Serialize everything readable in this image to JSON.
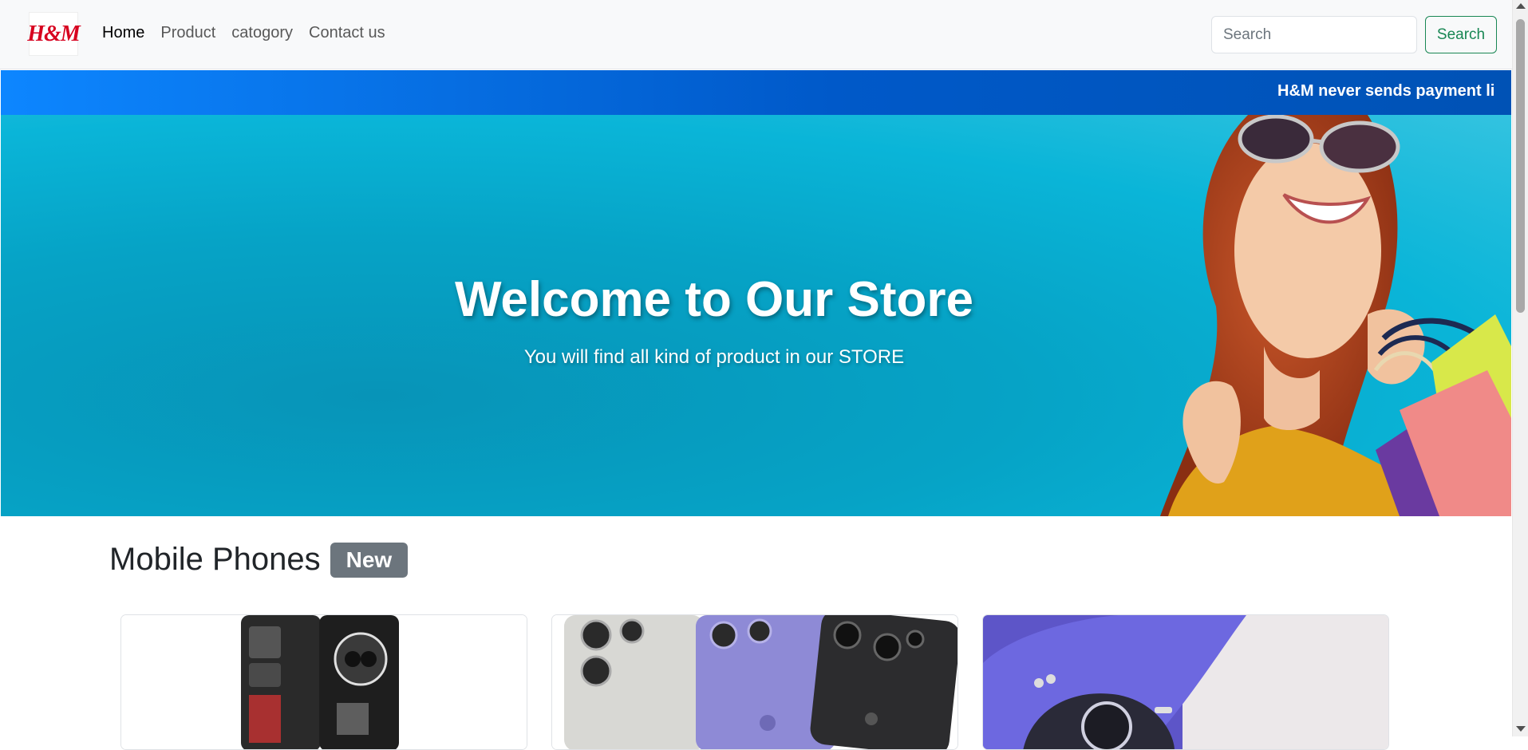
{
  "brand": {
    "logo_text": "H&M"
  },
  "nav": {
    "links": [
      {
        "label": "Home",
        "active": true
      },
      {
        "label": "Product",
        "active": false
      },
      {
        "label": "catogory",
        "active": false
      },
      {
        "label": "Contact us",
        "active": false
      }
    ]
  },
  "search": {
    "placeholder": "Search",
    "button_label": "Search"
  },
  "marquee": {
    "text": "H&M never sends payment li"
  },
  "hero": {
    "title": "Welcome to Our Store",
    "subtitle": "You will find all kind of product in our STORE"
  },
  "section": {
    "title": "Mobile Phones",
    "badge": "New"
  },
  "colors": {
    "search_button": "#198754",
    "badge": "#6c757d",
    "marquee_start": "#0d86ff",
    "marquee_end": "#0052b5",
    "hero_bg": "#06a3c6",
    "logo": "#d7001f"
  }
}
